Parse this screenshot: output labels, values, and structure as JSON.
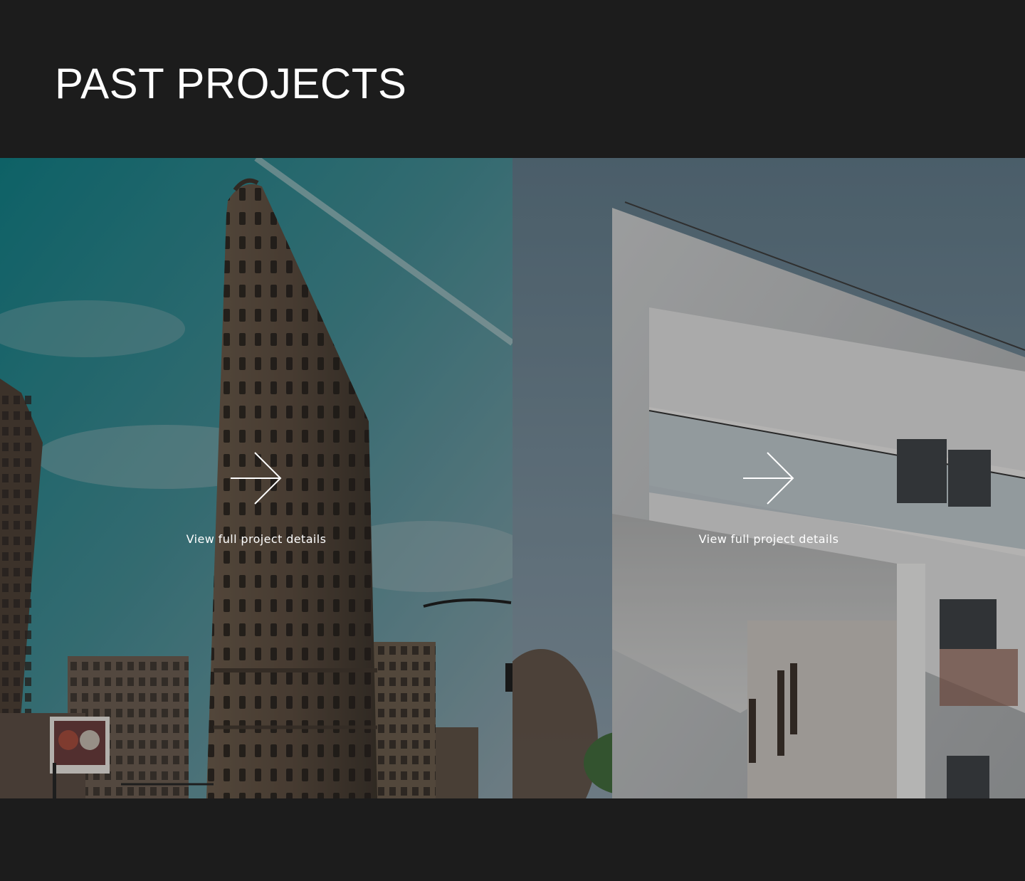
{
  "header": {
    "title": "PAST PROJECTS"
  },
  "projects": [
    {
      "image_subject": "flatiron-building-photo",
      "cta_label": "View full project details",
      "icon": "arrow-right-icon"
    },
    {
      "image_subject": "modern-white-building-photo",
      "cta_label": "View full project details",
      "icon": "arrow-right-icon"
    }
  ],
  "colors": {
    "background": "#1c1c1c",
    "text": "#ffffff"
  }
}
